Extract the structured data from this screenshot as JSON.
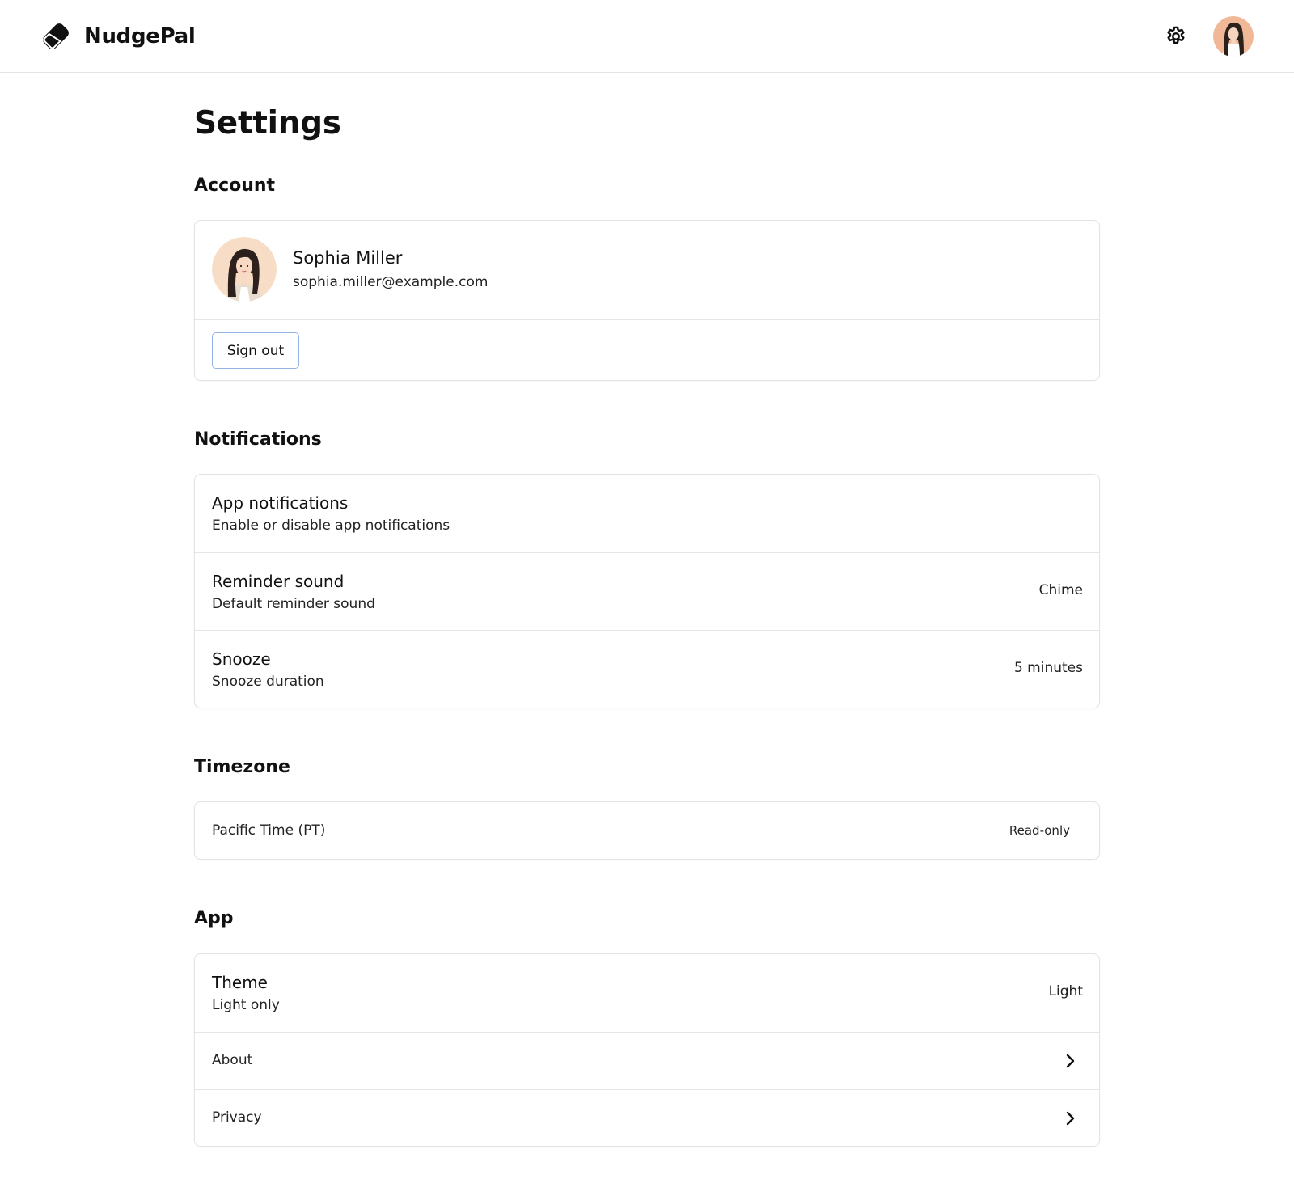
{
  "app": {
    "name": "NudgePal"
  },
  "header": {
    "settings_icon": "gear-icon",
    "avatar": "user-avatar"
  },
  "page": {
    "title": "Settings"
  },
  "account": {
    "heading": "Account",
    "name": "Sophia Miller",
    "email": "sophia.miller@example.com",
    "sign_out_label": "Sign out"
  },
  "notifications": {
    "heading": "Notifications",
    "items": [
      {
        "title": "App notifications",
        "subtitle": "Enable or disable app notifications",
        "value": ""
      },
      {
        "title": "Reminder sound",
        "subtitle": "Default reminder sound",
        "value": "Chime"
      },
      {
        "title": "Snooze",
        "subtitle": "Snooze duration",
        "value": "5 minutes"
      }
    ]
  },
  "timezone": {
    "heading": "Timezone",
    "value": "Pacific Time (PT)",
    "badge": "Read-only"
  },
  "app_section": {
    "heading": "App",
    "theme": {
      "title": "Theme",
      "subtitle": "Light only",
      "value": "Light"
    },
    "links": [
      {
        "label": "About",
        "icon": "chevron-right-icon"
      },
      {
        "label": "Privacy",
        "icon": "chevron-right-icon"
      }
    ]
  },
  "colors": {
    "text": "#111111",
    "border": "#e3e3e3",
    "button_border": "#94b4e6",
    "avatar_bg": "#f3c9a6"
  }
}
